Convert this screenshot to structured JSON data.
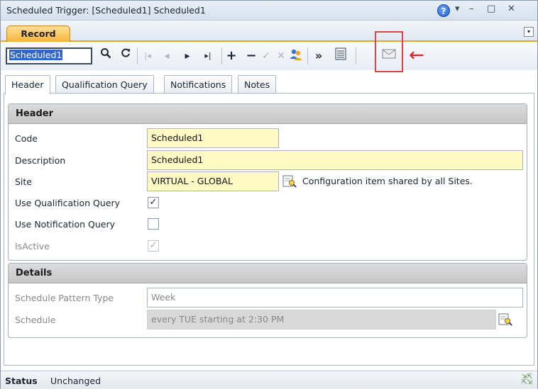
{
  "window": {
    "title": "Scheduled Trigger: [Scheduled1] Scheduled1",
    "help_glyph": "?",
    "menu_glyph": "▾",
    "minimize_glyph": "–",
    "maximize_glyph": "□",
    "close_glyph": "✕"
  },
  "ribbon": {
    "record_tab_label": "Record",
    "dropdown_glyph": "▾"
  },
  "toolbar": {
    "code_value": "Scheduled1",
    "search_icon": "search-icon",
    "refresh_icon": "refresh-icon",
    "first_glyph": "|◂",
    "prev_glyph": "◂",
    "next_glyph": "▸",
    "last_glyph": "▸|",
    "add_glyph": "+",
    "remove_glyph": "−",
    "save_glyph": "✓",
    "cancel_glyph": "✕",
    "more_glyph": "»"
  },
  "tabs": [
    {
      "label": "Header"
    },
    {
      "label": "Qualification Query"
    },
    {
      "label": "Notifications"
    },
    {
      "label": "Notes"
    }
  ],
  "header_section": {
    "title": "Header",
    "code_label": "Code",
    "code_value": "Scheduled1",
    "description_label": "Description",
    "description_value": "Scheduled1",
    "site_label": "Site",
    "site_value": "VIRTUAL - GLOBAL",
    "site_note": "Configuration item shared by all Sites.",
    "use_qualification_label": "Use Qualification Query",
    "use_qualification_checked": true,
    "use_notification_label": "Use Notification Query",
    "use_notification_checked": false,
    "isactive_label": "IsActive",
    "isactive_checked": true
  },
  "details_section": {
    "title": "Details",
    "schedule_pattern_label": "Schedule Pattern Type",
    "schedule_pattern_value": "Week",
    "schedule_label": "Schedule",
    "schedule_value": "every TUE starting at 2:30 PM"
  },
  "status": {
    "label": "Status",
    "value": "Unchanged"
  },
  "annotation": {
    "arrow_glyph": "←",
    "color": "#e02020"
  }
}
